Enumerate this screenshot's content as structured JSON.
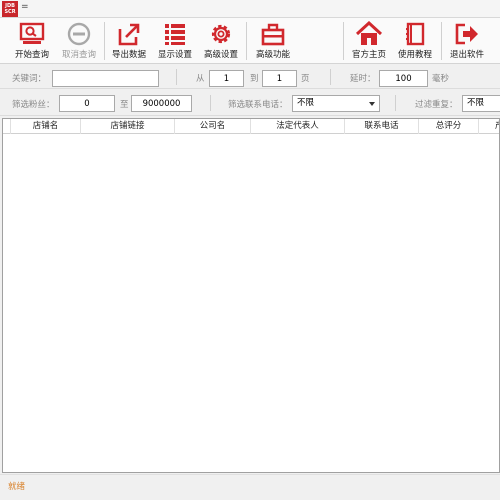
{
  "window": {
    "title": "=",
    "logo_text": "JDB\nSCR"
  },
  "toolbar": {
    "buttons": [
      {
        "label": "开始查询",
        "icon": "search-monitor-icon"
      },
      {
        "label": "取消查询",
        "icon": "minus-circle-icon"
      },
      {
        "label": "导出数据",
        "icon": "export-icon"
      },
      {
        "label": "显示设置",
        "icon": "list-icon"
      },
      {
        "label": "高级设置",
        "icon": "gear-icon"
      },
      {
        "label": "高级功能",
        "icon": "toolbox-icon"
      },
      {
        "label": "官方主页",
        "icon": "home-icon"
      },
      {
        "label": "使用教程",
        "icon": "book-icon"
      },
      {
        "label": "退出软件",
        "icon": "exit-icon"
      }
    ]
  },
  "search": {
    "keyword_label": "关键词：",
    "keyword_value": "",
    "from_label": "从",
    "from_value": "1",
    "to_label": "到",
    "to_value": "1",
    "page_label": "页",
    "delay_label": "延时：",
    "delay_value": "100",
    "ms_label": "毫秒"
  },
  "filter": {
    "fans_label": "筛选粉丝：",
    "fans_min": "0",
    "fans_to": "至",
    "fans_max": "9000000",
    "phone_label": "筛选联系电话：",
    "phone_value": "不限",
    "dup_label": "过滤重复：",
    "dup_value": "不限"
  },
  "table": {
    "columns": [
      "店铺名",
      "店铺链接",
      "公司名",
      "法定代表人",
      "联系电话",
      "总评分",
      "产"
    ]
  },
  "status": {
    "text": "就绪"
  },
  "colors": {
    "accent_red": "#d1282d",
    "status_orange": "#d9822b"
  }
}
